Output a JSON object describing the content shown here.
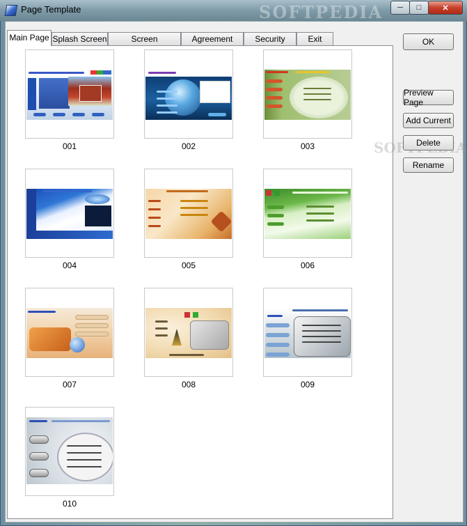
{
  "window": {
    "title": "Page Template",
    "watermark": "SOFTPEDIA",
    "watermark2": "SOFTPEDIA"
  },
  "tabs": [
    {
      "label": "Main Page",
      "active": true
    },
    {
      "label": "Splash Screen",
      "active": false
    },
    {
      "label": "Screen Background",
      "active": false
    },
    {
      "label": "Agreement Form",
      "active": false
    },
    {
      "label": "Security Form",
      "active": false
    },
    {
      "label": "Exit Form",
      "active": false
    }
  ],
  "templates": [
    {
      "label": "001",
      "theme": "barn"
    },
    {
      "label": "002",
      "theme": "globe"
    },
    {
      "label": "003",
      "theme": "green-oval"
    },
    {
      "label": "004",
      "theme": "blue-wave"
    },
    {
      "label": "005",
      "theme": "autumn"
    },
    {
      "label": "006",
      "theme": "green-wave"
    },
    {
      "label": "007",
      "theme": "orange"
    },
    {
      "label": "008",
      "theme": "beige"
    },
    {
      "label": "009",
      "theme": "silver"
    },
    {
      "label": "010",
      "theme": "gray-oval"
    }
  ],
  "buttons": {
    "ok": "OK",
    "preview": "Preview Page",
    "add": "Add Current",
    "delete": "Delete",
    "rename": "Rename"
  },
  "colors": {
    "accent": "#3a6fd0",
    "close": "#c8402a"
  }
}
